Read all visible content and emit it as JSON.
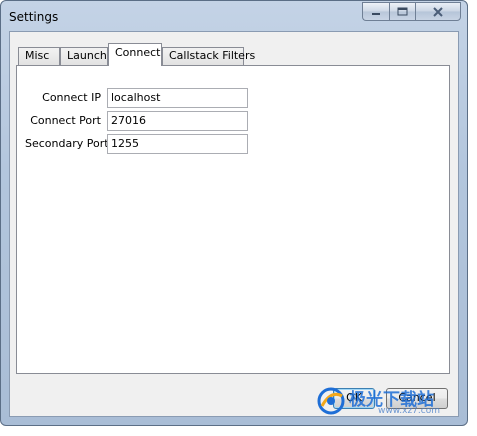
{
  "window": {
    "title": "Settings",
    "caption_buttons": [
      "minimize-icon",
      "maximize-icon",
      "close-icon"
    ]
  },
  "tabs": [
    {
      "label": "Misc",
      "active": false
    },
    {
      "label": "Launch",
      "active": false
    },
    {
      "label": "Connect",
      "active": true
    },
    {
      "label": "Callstack Filters",
      "active": false
    }
  ],
  "connect": {
    "ip_label": "Connect IP",
    "ip_value": "localhost",
    "port_label": "Connect Port",
    "port_value": "27016",
    "secondary_port_label": "Secondary Port",
    "secondary_port_value": "1255"
  },
  "buttons": {
    "ok_label": "OK",
    "cancel_label": "Cancel"
  },
  "watermark": {
    "text": "极光下载站",
    "url": "www.xz7.com"
  },
  "colors": {
    "frame": "#b3c6dd",
    "close_x": "#6b7e98",
    "watermark_blue": "#1e6ed6"
  }
}
